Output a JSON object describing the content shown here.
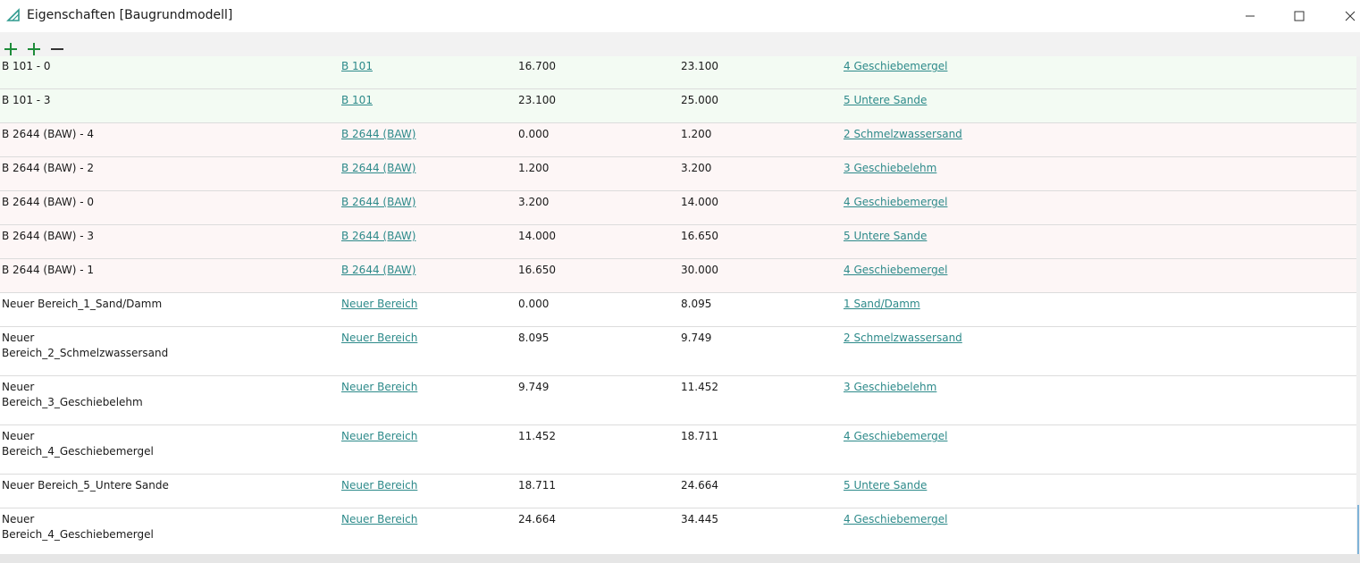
{
  "window": {
    "title": "Eigenschaften [Baugrundmodell]",
    "accent_color": "#2e9a8e",
    "icons": {
      "app": "triangle-app-icon",
      "minimize": "minimize-icon",
      "maximize": "maximize-icon",
      "close": "close-icon"
    }
  },
  "toolbar": {
    "icons": [
      "add-icon",
      "add-icon",
      "remove-icon"
    ],
    "add_color": "#1e8c3a"
  },
  "rows": [
    {
      "name": "B 101 - 0",
      "bereich": "B 101",
      "von": "16.700",
      "bis": "23.100",
      "schicht": "4 Geschiebemergel",
      "tint": "green"
    },
    {
      "name": "B 101 - 3",
      "bereich": "B 101",
      "von": "23.100",
      "bis": "25.000",
      "schicht": "5 Untere Sande",
      "tint": "green"
    },
    {
      "name": "B 2644 (BAW) - 4",
      "bereich": "B 2644 (BAW)",
      "von": "0.000",
      "bis": "1.200",
      "schicht": "2 Schmelzwassersand",
      "tint": "pink"
    },
    {
      "name": "B 2644 (BAW) - 2",
      "bereich": "B 2644 (BAW)",
      "von": "1.200",
      "bis": "3.200",
      "schicht": "3 Geschiebelehm",
      "tint": "pink"
    },
    {
      "name": "B 2644 (BAW) - 0",
      "bereich": "B 2644 (BAW)",
      "von": "3.200",
      "bis": "14.000",
      "schicht": "4 Geschiebemergel",
      "tint": "pink"
    },
    {
      "name": "B 2644 (BAW) - 3",
      "bereich": "B 2644 (BAW)",
      "von": "14.000",
      "bis": "16.650",
      "schicht": "5 Untere Sande",
      "tint": "pink"
    },
    {
      "name": "B 2644 (BAW) - 1",
      "bereich": "B 2644 (BAW)",
      "von": "16.650",
      "bis": "30.000",
      "schicht": "4 Geschiebemergel",
      "tint": "pink"
    },
    {
      "name": "Neuer Bereich_1_Sand/Damm",
      "bereich": "Neuer Bereich",
      "von": "0.000",
      "bis": "8.095",
      "schicht": "1 Sand/Damm",
      "tint": "plain"
    },
    {
      "name_lines": [
        "Neuer",
        "Bereich_2_Schmelzwassersand"
      ],
      "bereich": "Neuer Bereich",
      "von": "8.095",
      "bis": "9.749",
      "schicht": "2 Schmelzwassersand",
      "tint": "plain"
    },
    {
      "name_lines": [
        "Neuer",
        "Bereich_3_Geschiebelehm"
      ],
      "bereich": "Neuer Bereich",
      "von": "9.749",
      "bis": "11.452",
      "schicht": "3 Geschiebelehm",
      "tint": "plain"
    },
    {
      "name_lines": [
        "Neuer",
        "Bereich_4_Geschiebemergel"
      ],
      "bereich": "Neuer Bereich",
      "von": "11.452",
      "bis": "18.711",
      "schicht": "4 Geschiebemergel",
      "tint": "plain"
    },
    {
      "name": "Neuer Bereich_5_Untere Sande",
      "bereich": "Neuer Bereich",
      "von": "18.711",
      "bis": "24.664",
      "schicht": "5 Untere Sande",
      "tint": "plain"
    },
    {
      "name_lines": [
        "Neuer",
        "Bereich_4_Geschiebemergel"
      ],
      "bereich": "Neuer Bereich",
      "von": "24.664",
      "bis": "34.445",
      "schicht": "4 Geschiebemergel",
      "tint": "plain"
    }
  ]
}
